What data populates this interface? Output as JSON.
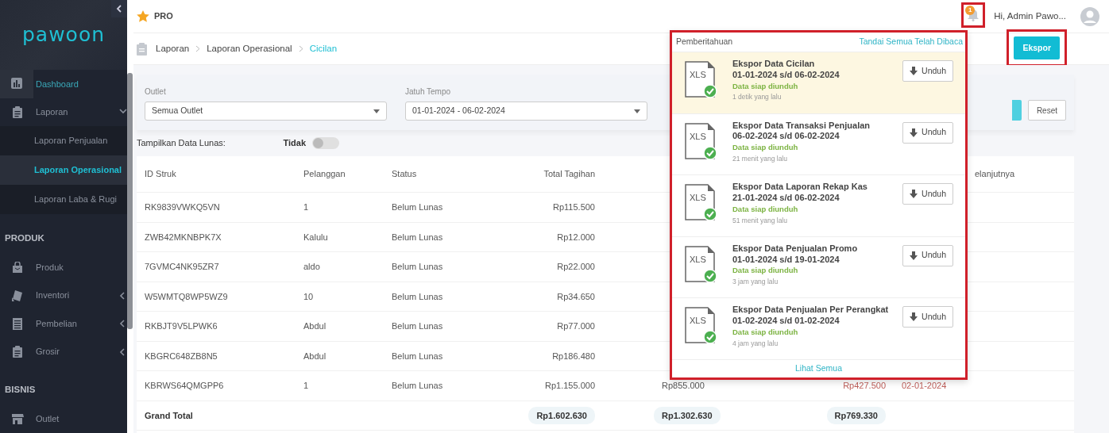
{
  "sidebar": {
    "logo": "pawoon",
    "menu": [
      {
        "label": "Dashboard",
        "hovered": true
      },
      {
        "label": "Laporan",
        "hovered": false,
        "expanded": true,
        "children": [
          {
            "label": "Laporan Penjualan",
            "selected": false
          },
          {
            "label": "Laporan Operasional",
            "selected": true
          },
          {
            "label": "Laporan Laba & Rugi",
            "selected": false
          }
        ]
      }
    ],
    "sections": [
      {
        "title": "PRODUK",
        "items": [
          {
            "label": "Produk"
          },
          {
            "label": "Inventori",
            "expanded": false
          },
          {
            "label": "Pembelian",
            "expanded": false
          },
          {
            "label": "Grosir",
            "expanded": false
          }
        ]
      },
      {
        "title": "BISNIS",
        "items": [
          {
            "label": "Outlet"
          }
        ]
      }
    ]
  },
  "topbar": {
    "plan": "PRO",
    "notification_count": "1",
    "greeting": "Hi, Admin Pawo..."
  },
  "breadcrumb": [
    "Laporan",
    "Laporan Operasional",
    "Cicilan"
  ],
  "export_button": "Ekspor",
  "filters": [
    {
      "label": "Outlet",
      "value": "Semua Outlet"
    },
    {
      "label": "Jatuh Tempo",
      "value": "01-01-2024 - 06-02-2024"
    }
  ],
  "reset_button": "Reset",
  "toggle": {
    "label": "Tampilkan Data Lunas:",
    "state_text": "Tidak",
    "on": false
  },
  "table": {
    "columns": [
      "ID Struk",
      "Pelanggan",
      "Status",
      "Total Tagihan"
    ],
    "partial_column": "elanjutnya",
    "rows": [
      {
        "id": "RK9839VWKQ5VN",
        "customer": "1",
        "status": "Belum Lunas",
        "total": "Rp115.500"
      },
      {
        "id": "ZWB42MKNBPK7X",
        "customer": "Kalulu",
        "status": "Belum Lunas",
        "total": "Rp12.000"
      },
      {
        "id": "7GVMC4NK95ZR7",
        "customer": "aldo",
        "status": "Belum Lunas",
        "total": "Rp22.000"
      },
      {
        "id": "W5WMTQ8WP5WZ9",
        "customer": "10",
        "status": "Belum Lunas",
        "total": "Rp34.650"
      },
      {
        "id": "RKBJT9V5LPWK6",
        "customer": "Abdul",
        "status": "Belum Lunas",
        "total": "Rp77.000"
      },
      {
        "id": "KBGRC648ZB8N5",
        "customer": "Abdul",
        "status": "Belum Lunas",
        "total": "Rp186.480"
      },
      {
        "id": "KBRWS64QMGPP6",
        "customer": "1",
        "status": "Belum Lunas",
        "total": "Rp1.155.000",
        "extra": [
          "Rp855.000",
          "Rp427.500",
          "02-01-2024"
        ]
      }
    ],
    "grand_total": {
      "label": "Grand Total",
      "values": [
        "Rp1.602.630",
        "Rp1.302.630",
        "Rp769.330"
      ]
    }
  },
  "notifications": {
    "title": "Pemberitahuan",
    "mark_all": "Tandai Semua Telah Dibaca",
    "footer": "Lihat Semua",
    "items": [
      {
        "title": "Ekspor Data Cicilan",
        "range": "01-01-2024 s/d 06-02-2024",
        "status": "Data siap diunduh",
        "time": "1 detik yang lalu",
        "file_type": "XLS",
        "unread": true,
        "button": "Unduh"
      },
      {
        "title": "Ekspor Data Transaksi Penjualan",
        "range": "06-02-2024 s/d 06-02-2024",
        "status": "Data siap diunduh",
        "time": "21 menit yang lalu",
        "file_type": "XLS",
        "unread": false,
        "button": "Unduh"
      },
      {
        "title": "Ekspor Data Laporan Rekap Kas",
        "range": "21-01-2024 s/d 06-02-2024",
        "status": "Data siap diunduh",
        "time": "51 menit yang lalu",
        "file_type": "XLS",
        "unread": false,
        "button": "Unduh"
      },
      {
        "title": "Ekspor Data Penjualan Promo",
        "range": "01-01-2024 s/d 19-01-2024",
        "status": "Data siap diunduh",
        "time": "3 jam yang lalu",
        "file_type": "XLS",
        "unread": false,
        "button": "Unduh"
      },
      {
        "title": "Ekspor Data Penjualan Per Perangkat",
        "range": "01-02-2024 s/d 01-02-2024",
        "status": "Data siap diunduh",
        "time": "4 jam yang lalu",
        "file_type": "XLS",
        "unread": false,
        "button": "Unduh"
      }
    ]
  }
}
